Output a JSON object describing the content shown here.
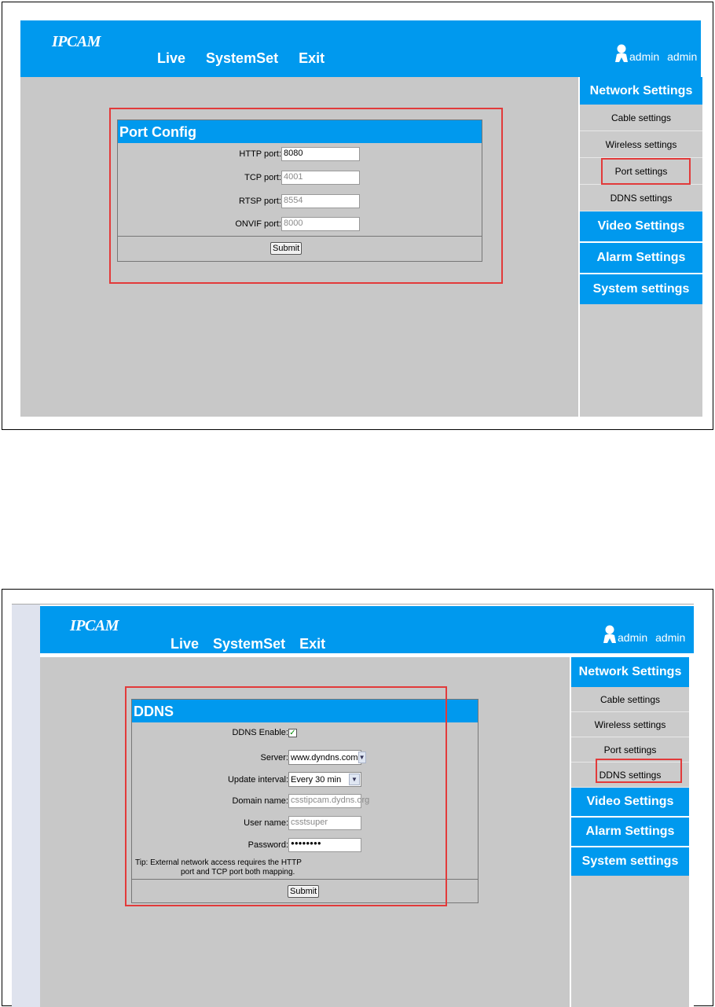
{
  "header": {
    "logo": "IPCAM",
    "nav": [
      "Live",
      "SystemSet",
      "Exit"
    ],
    "user": [
      "admin",
      "admin"
    ]
  },
  "sidebar": {
    "network_settings": "Network Settings",
    "items": [
      "Cable settings",
      "Wireless settings",
      "Port settings",
      "DDNS settings"
    ],
    "video_settings": "Video Settings",
    "alarm_settings": "Alarm Settings",
    "system_settings": "System settings"
  },
  "port_config": {
    "title": "Port Config",
    "http_label": "HTTP port:",
    "http_value": "8080",
    "tcp_label": "TCP port:",
    "tcp_value": "4001",
    "rtsp_label": "RTSP port:",
    "rtsp_value": "8554",
    "onvif_label": "ONVIF port:",
    "onvif_value": "8000",
    "submit": "Submit"
  },
  "ddns": {
    "title": "DDNS",
    "enable_label": "DDNS Enable:",
    "enable_checked": "✓",
    "server_label": "Server:",
    "server_value": "www.dyndns.com",
    "interval_label": "Update interval:",
    "interval_value": "Every 30 min",
    "domain_label": "Domain name:",
    "domain_value": "csstipcam.dydns.org",
    "user_label": "User name:",
    "user_value": "csstsuper",
    "password_label": "Password:",
    "password_value": "●●●●●●●●",
    "tip_line1": "Tip: External network access requires the HTTP",
    "tip_line2": "port and TCP port both mapping.",
    "submit": "Submit"
  },
  "colors": {
    "accent": "#0099ee",
    "panel_bg": "#c8c8c8",
    "highlight": "#e23a3a"
  }
}
